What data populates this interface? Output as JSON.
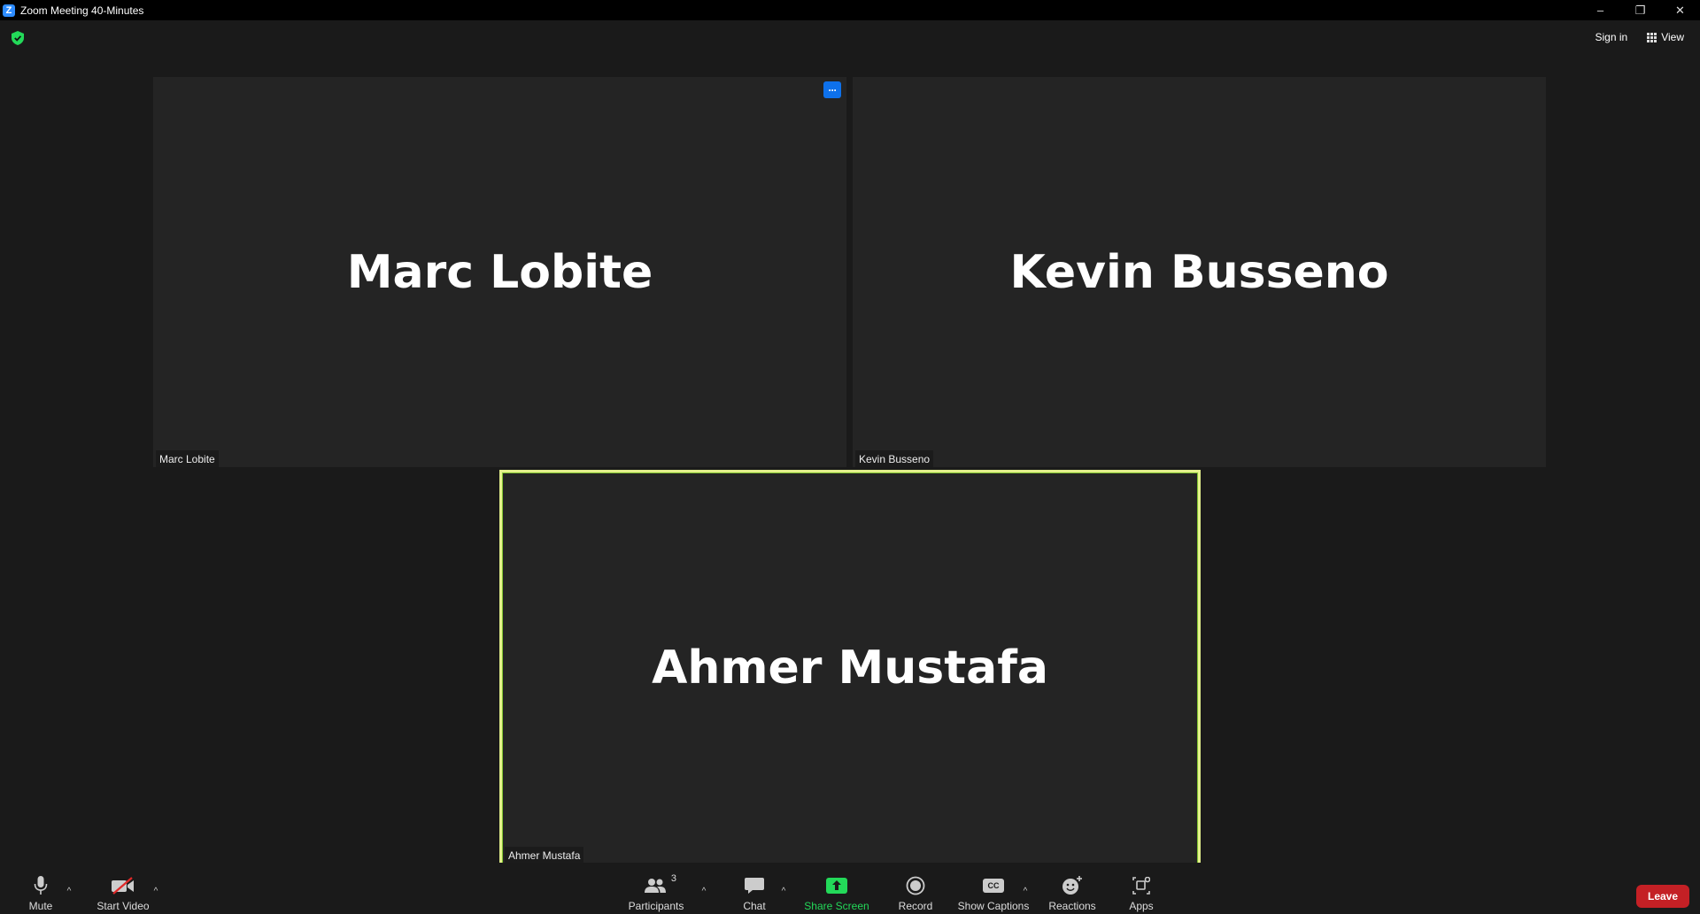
{
  "window": {
    "title": "Zoom Meeting 40-Minutes",
    "app_icon_letter": "Z",
    "controls": {
      "minimize": "–",
      "restore": "❐",
      "close": "✕"
    }
  },
  "header": {
    "security_icon_color": "#23d959",
    "sign_in_label": "Sign in",
    "view_label": "View"
  },
  "tiles": [
    {
      "name": "Marc Lobite",
      "label": "Marc Lobite",
      "has_more_button": true,
      "more_label": "···"
    },
    {
      "name": "Kevin Busseno",
      "label": "Kevin Busseno"
    },
    {
      "name": "Ahmer Mustafa",
      "label": "Ahmer Mustafa",
      "active_speaker": true
    }
  ],
  "toolbar": {
    "mute_label": "Mute",
    "start_video_label": "Start Video",
    "participants_label": "Participants",
    "participants_count": "3",
    "chat_label": "Chat",
    "share_screen_label": "Share Screen",
    "record_label": "Record",
    "show_captions_label": "Show Captions",
    "captions_icon_text": "CC",
    "reactions_label": "Reactions",
    "apps_label": "Apps",
    "leave_label": "Leave",
    "caret": "^"
  },
  "colors": {
    "accent_blue": "#0e71eb",
    "share_green": "#23d959",
    "leave_red": "#c42025",
    "active_border": "#e4f08c"
  }
}
